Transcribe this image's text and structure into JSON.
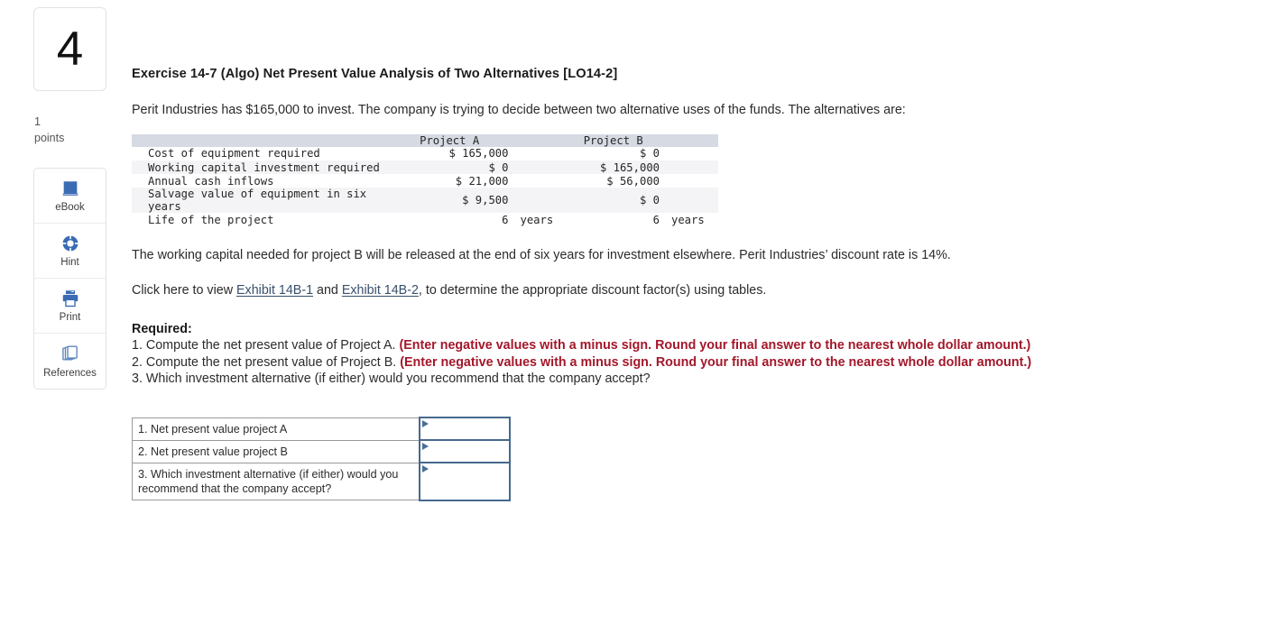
{
  "sidebar": {
    "question_number": "4",
    "points_value": "1",
    "points_label": "points",
    "tools": [
      {
        "label": "eBook",
        "icon": "book-icon"
      },
      {
        "label": "Hint",
        "icon": "life-ring-icon"
      },
      {
        "label": "Print",
        "icon": "printer-icon"
      },
      {
        "label": "References",
        "icon": "pages-stack-icon"
      }
    ]
  },
  "exercise": {
    "title": "Exercise 14-7 (Algo) Net Present Value Analysis of Two Alternatives [LO14-2]",
    "intro": "Perit Industries has $165,000 to invest. The company is trying to decide between two alternative uses of the funds. The alternatives are:",
    "note": "The working capital needed for project B will be released at the end of six years for investment elsewhere. Perit Industries’ discount rate is 14%.",
    "exhibit_prefix": "Click here to view ",
    "exhibit_link_1": "Exhibit 14B-1",
    "exhibit_conjunction": " and ",
    "exhibit_link_2": "Exhibit 14B-2",
    "exhibit_suffix": ", to determine the appropriate discount factor(s) using tables."
  },
  "data_table": {
    "headers": [
      "",
      "Project A",
      "",
      "Project B",
      ""
    ],
    "rows": [
      {
        "label": "Cost of equipment required",
        "a": "$ 165,000",
        "a_unit": "",
        "b": "$ 0",
        "b_unit": ""
      },
      {
        "label": "Working capital investment required",
        "a": "$ 0",
        "a_unit": "",
        "b": "$ 165,000",
        "b_unit": ""
      },
      {
        "label": "Annual cash inflows",
        "a": "$ 21,000",
        "a_unit": "",
        "b": "$ 56,000",
        "b_unit": ""
      },
      {
        "label": "Salvage value of equipment in six years",
        "a": "$ 9,500",
        "a_unit": "",
        "b": "$ 0",
        "b_unit": ""
      },
      {
        "label": "Life of the project",
        "a": "6",
        "a_unit": "years",
        "b": "6",
        "b_unit": "years"
      }
    ]
  },
  "required": {
    "heading": "Required:",
    "item1_plain": "1. Compute the net present value of Project A. ",
    "item1_red": "(Enter negative values with a minus sign. Round your final answer to the nearest whole dollar amount.)",
    "item2_plain": "2. Compute the net present value of Project B. ",
    "item2_red": "(Enter negative values with a minus sign. Round your final answer to the nearest whole dollar amount.)",
    "item3": "3. Which investment alternative (if either) would you recommend that the company accept?"
  },
  "answer_table": {
    "rows": [
      {
        "question": "1. Net present value project A",
        "value": ""
      },
      {
        "question": "2. Net present value project B",
        "value": ""
      },
      {
        "question": "3. Which investment alternative (if either) would you recommend that the company accept?",
        "value": ""
      }
    ]
  },
  "colors": {
    "red_instruction": "#a3172a",
    "link": "#39506b",
    "table_header_band": "#d5dae3",
    "answer_input_border": "#46698e",
    "icon_blue": "#3b6cb3"
  }
}
